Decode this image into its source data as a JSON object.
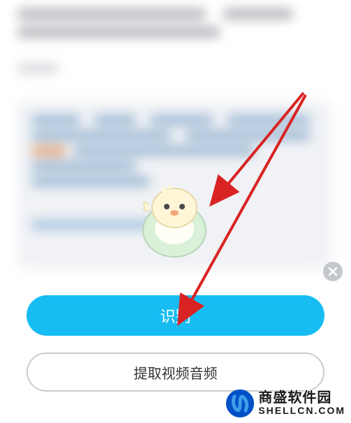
{
  "buttons": {
    "primary_label": "识别",
    "secondary_label": "提取视频音频"
  },
  "watermark": {
    "title": "商盛软件园",
    "url": "SHELLCN.COM"
  },
  "icons": {
    "close": "close-icon",
    "logo": "logo-icon",
    "mascot": "mascot-icon"
  },
  "colors": {
    "primary": "#17bdf2",
    "arrow": "#d92323",
    "close_bg": "#c4c7cb",
    "logo_bg": "#0050c8"
  }
}
